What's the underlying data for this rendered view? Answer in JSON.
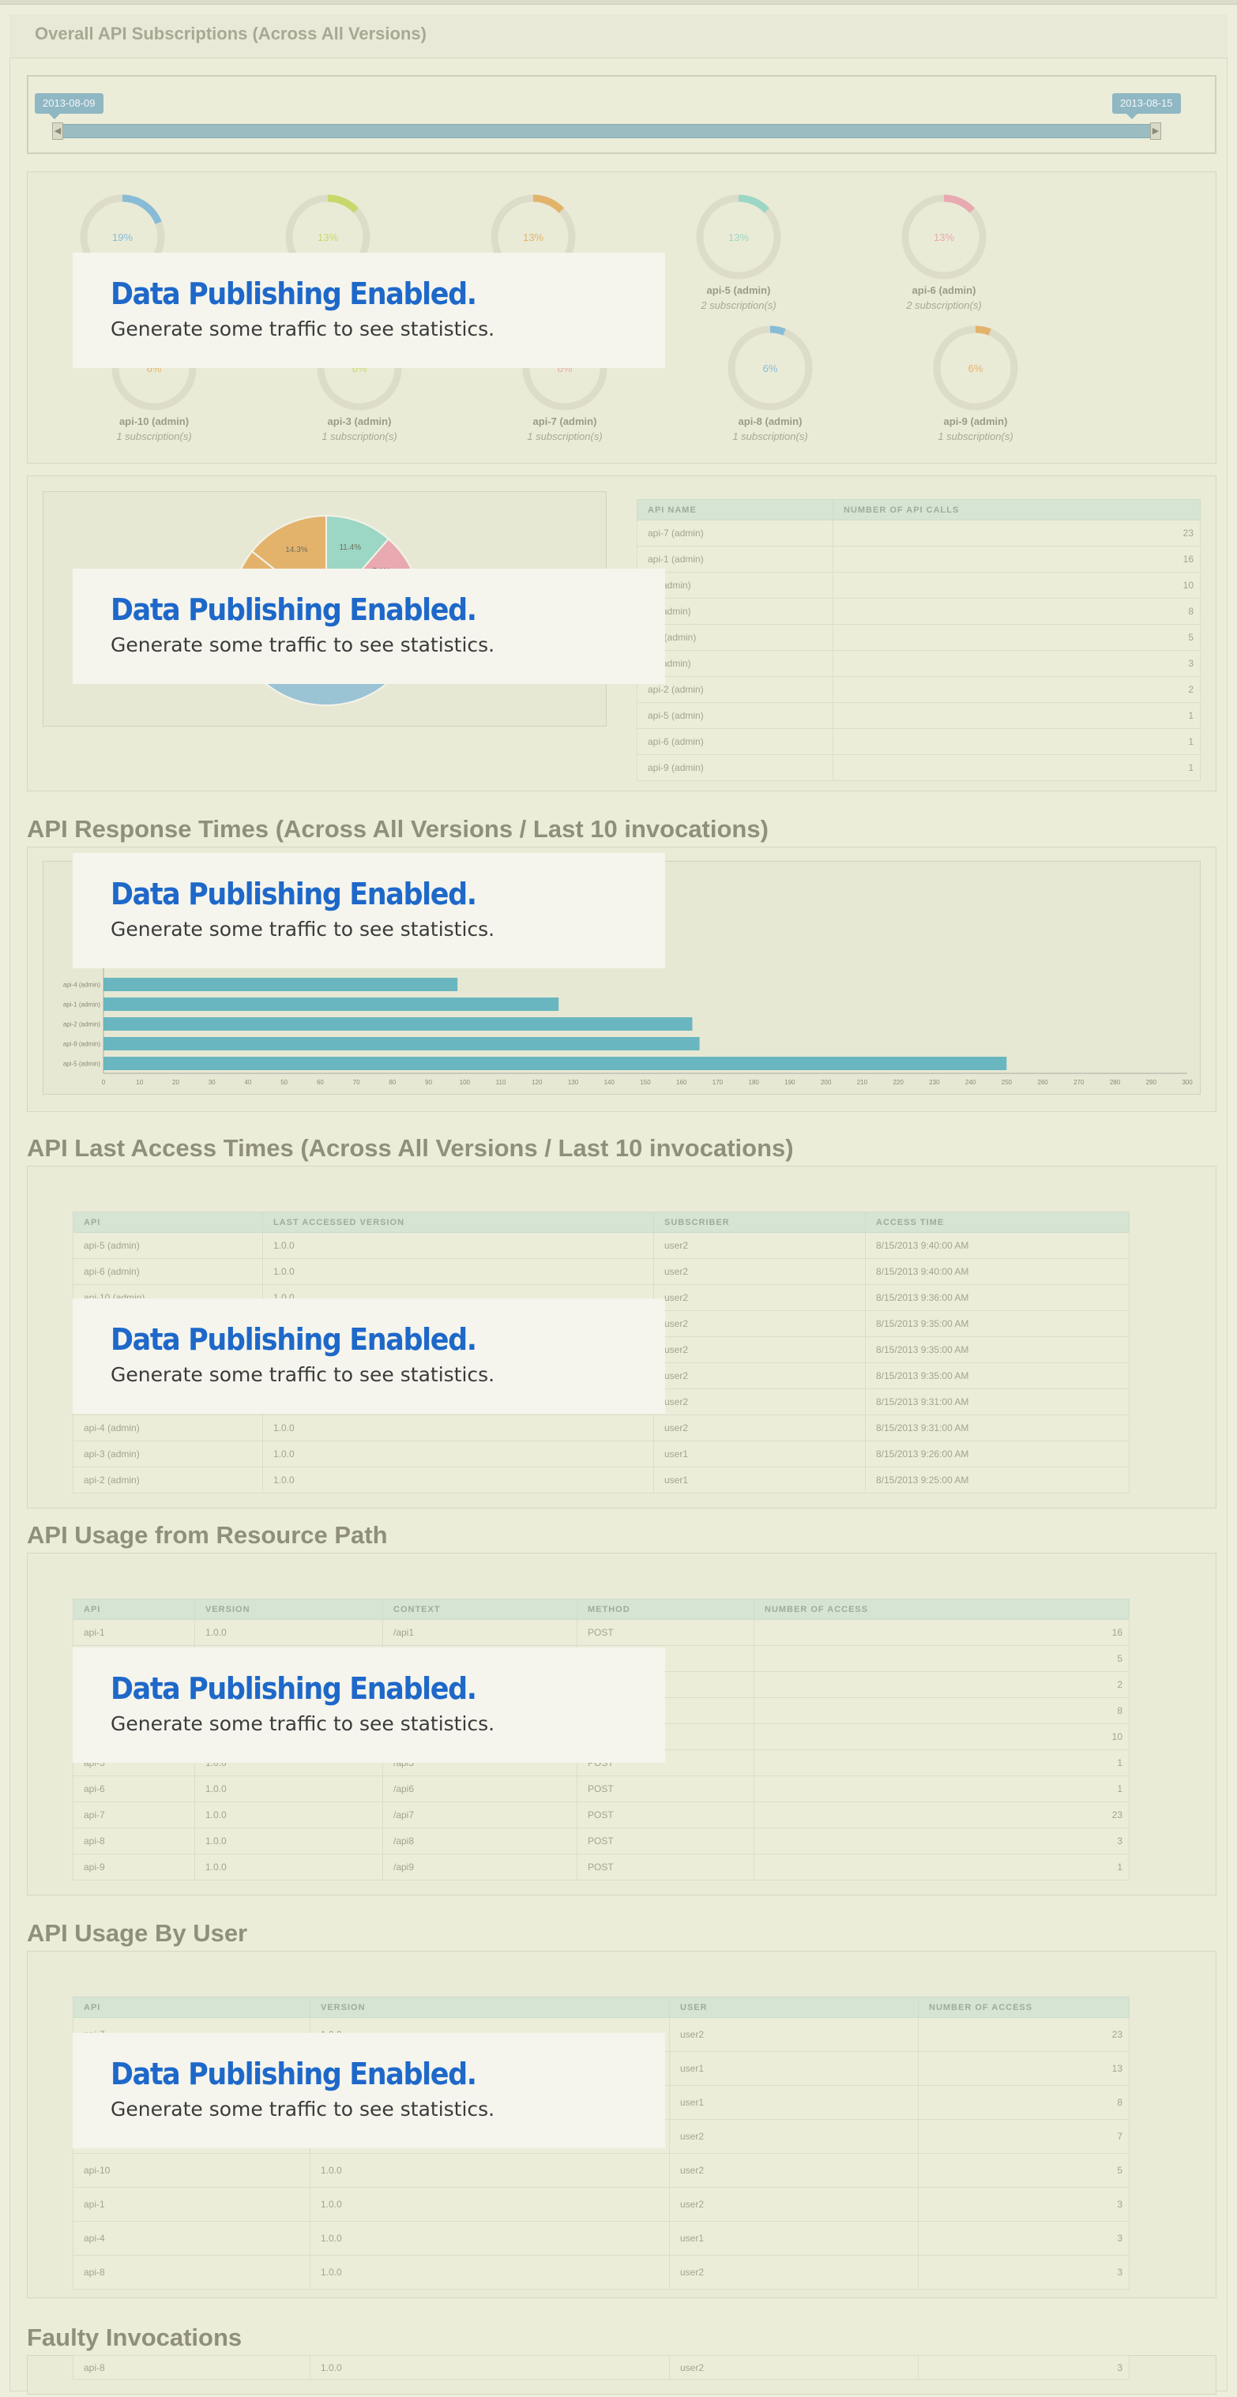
{
  "page_title": "Overall API Subscriptions (Across All Versions)",
  "slider": {
    "start_date": "2013-08-09",
    "end_date": "2013-08-15"
  },
  "overlay": {
    "title": "Data Publishing Enabled.",
    "subtitle": "Generate some traffic to see statistics."
  },
  "donuts": [
    {
      "pct": "19%",
      "fraction": 0.19,
      "color": "#88bcd6",
      "name": "",
      "subs": ""
    },
    {
      "pct": "13%",
      "fraction": 0.13,
      "color": "#c8d86a",
      "name": "",
      "subs": ""
    },
    {
      "pct": "13%",
      "fraction": 0.13,
      "color": "#e3b36c",
      "name": "",
      "subs": ""
    },
    {
      "pct": "13%",
      "fraction": 0.13,
      "color": "#9cd6c4",
      "name": "api-5 (admin)",
      "subs": "2 subscription(s)"
    },
    {
      "pct": "13%",
      "fraction": 0.13,
      "color": "#e8a9b0",
      "name": "api-6 (admin)",
      "subs": "2 subscription(s)"
    },
    {
      "pct": "6%",
      "fraction": 0.06,
      "color": "#e3b36c",
      "name": "api-10 (admin)",
      "subs": "1 subscription(s)"
    },
    {
      "pct": "6%",
      "fraction": 0.06,
      "color": "#c8d86a",
      "name": "api-3 (admin)",
      "subs": "1 subscription(s)"
    },
    {
      "pct": "6%",
      "fraction": 0.06,
      "color": "#e8a9b0",
      "name": "api-7 (admin)",
      "subs": "1 subscription(s)"
    },
    {
      "pct": "6%",
      "fraction": 0.06,
      "color": "#88bcd6",
      "name": "api-8 (admin)",
      "subs": "1 subscription(s)"
    },
    {
      "pct": "6%",
      "fraction": 0.06,
      "color": "#e3b36c",
      "name": "api-9 (admin)",
      "subs": "1 subscription(s)"
    }
  ],
  "api_calls_table": {
    "headers": [
      "API NAME",
      "NUMBER OF API CALLS"
    ],
    "rows": [
      [
        "api-7 (admin)",
        "23"
      ],
      [
        "api-1 (admin)",
        "16"
      ],
      [
        "-4 (admin)",
        "10"
      ],
      [
        "-8 (admin)",
        "8"
      ],
      [
        "-10 (admin)",
        "5"
      ],
      [
        "-8 (admin)",
        "3"
      ],
      [
        "api-2 (admin)",
        "2"
      ],
      [
        "api-5 (admin)",
        "1"
      ],
      [
        "api-6 (admin)",
        "1"
      ],
      [
        "api-9 (admin)",
        "1"
      ]
    ]
  },
  "chart_data": [
    {
      "type": "pie",
      "title": "",
      "labels": [
        "11.4%",
        "7.1%",
        "4.3%",
        "14.3%"
      ],
      "values": [
        11.4,
        7.1,
        4.3,
        14.3
      ],
      "colors": [
        "#9cd6c4",
        "#e8a9b0",
        "#e3b36c",
        "#e3b36c"
      ]
    },
    {
      "type": "bar",
      "orientation": "horizontal",
      "categories": [
        "api-8",
        "api-6",
        "api-10",
        "api-3",
        "api-7",
        "api-4 (admin)",
        "api-1 (admin)",
        "api-2 (admin)",
        "api-9 (admin)",
        "api-5 (admin)"
      ],
      "values": [
        0,
        0,
        0,
        0,
        0,
        98,
        126,
        163,
        165,
        250
      ],
      "xlim": [
        0,
        300
      ],
      "xticks": [
        0,
        10,
        20,
        30,
        40,
        50,
        60,
        70,
        80,
        90,
        100,
        110,
        120,
        130,
        140,
        150,
        160,
        170,
        180,
        190,
        200,
        210,
        220,
        230,
        240,
        250,
        260,
        270,
        280,
        290,
        300
      ],
      "color": "#6ab6c0"
    }
  ],
  "sections": {
    "response_times": "API Response Times (Across All Versions / Last 10 invocations)",
    "last_access": "API Last Access Times (Across All Versions / Last 10 invocations)",
    "resource_path": "API Usage from Resource Path",
    "by_user": "API Usage By User",
    "faulty": "Faulty Invocations"
  },
  "last_access_table": {
    "headers": [
      "API",
      "LAST ACCESSED VERSION",
      "SUBSCRIBER",
      "ACCESS TIME"
    ],
    "rows": [
      [
        "api-5 (admin)",
        "1.0.0",
        "user2",
        "8/15/2013 9:40:00 AM"
      ],
      [
        "api-6 (admin)",
        "1.0.0",
        "user2",
        "8/15/2013 9:40:00 AM"
      ],
      [
        "api-10 (admin)",
        "1.0.0",
        "user2",
        "8/15/2013 9:36:00 AM"
      ],
      [
        "",
        "",
        "user2",
        "8/15/2013 9:35:00 AM"
      ],
      [
        "",
        "",
        "user2",
        "8/15/2013 9:35:00 AM"
      ],
      [
        "",
        "",
        "user2",
        "8/15/2013 9:35:00 AM"
      ],
      [
        "",
        "",
        "user2",
        "8/15/2013 9:31:00 AM"
      ],
      [
        "api-4 (admin)",
        "1.0.0",
        "user2",
        "8/15/2013 9:31:00 AM"
      ],
      [
        "api-3 (admin)",
        "1.0.0",
        "user1",
        "8/15/2013 9:26:00 AM"
      ],
      [
        "api-2 (admin)",
        "1.0.0",
        "user1",
        "8/15/2013 9:25:00 AM"
      ]
    ]
  },
  "resource_table": {
    "headers": [
      "API",
      "VERSION",
      "CONTEXT",
      "METHOD",
      "NUMBER OF ACCESS"
    ],
    "rows": [
      [
        "api-1",
        "1.0.0",
        "/api1",
        "POST",
        "16"
      ],
      [
        "",
        "",
        "",
        "",
        "5"
      ],
      [
        "",
        "",
        "",
        "",
        "2"
      ],
      [
        "",
        "",
        "",
        "",
        "8"
      ],
      [
        "",
        "",
        "",
        "",
        "10"
      ],
      [
        "api-5",
        "1.0.0",
        "/api5",
        "POST",
        "1"
      ],
      [
        "api-6",
        "1.0.0",
        "/api6",
        "POST",
        "1"
      ],
      [
        "api-7",
        "1.0.0",
        "/api7",
        "POST",
        "23"
      ],
      [
        "api-8",
        "1.0.0",
        "/api8",
        "POST",
        "3"
      ],
      [
        "api-9",
        "1.0.0",
        "/api9",
        "POST",
        "1"
      ]
    ]
  },
  "user_table": {
    "headers": [
      "API",
      "VERSION",
      "USER",
      "NUMBER OF ACCESS"
    ],
    "rows": [
      [
        "api-7",
        "1.0.0",
        "user2",
        "23"
      ],
      [
        "",
        "",
        "user1",
        "13"
      ],
      [
        "",
        "",
        "user1",
        "8"
      ],
      [
        "",
        "",
        "user2",
        "7"
      ],
      [
        "api-10",
        "1.0.0",
        "user2",
        "5"
      ],
      [
        "api-1",
        "1.0.0",
        "user2",
        "3"
      ],
      [
        "api-4",
        "1.0.0",
        "user1",
        "3"
      ],
      [
        "api-8",
        "1.0.0",
        "user2",
        "3"
      ]
    ],
    "faulty_row": [
      "api-8",
      "1.0.0",
      "user2",
      "3"
    ]
  }
}
